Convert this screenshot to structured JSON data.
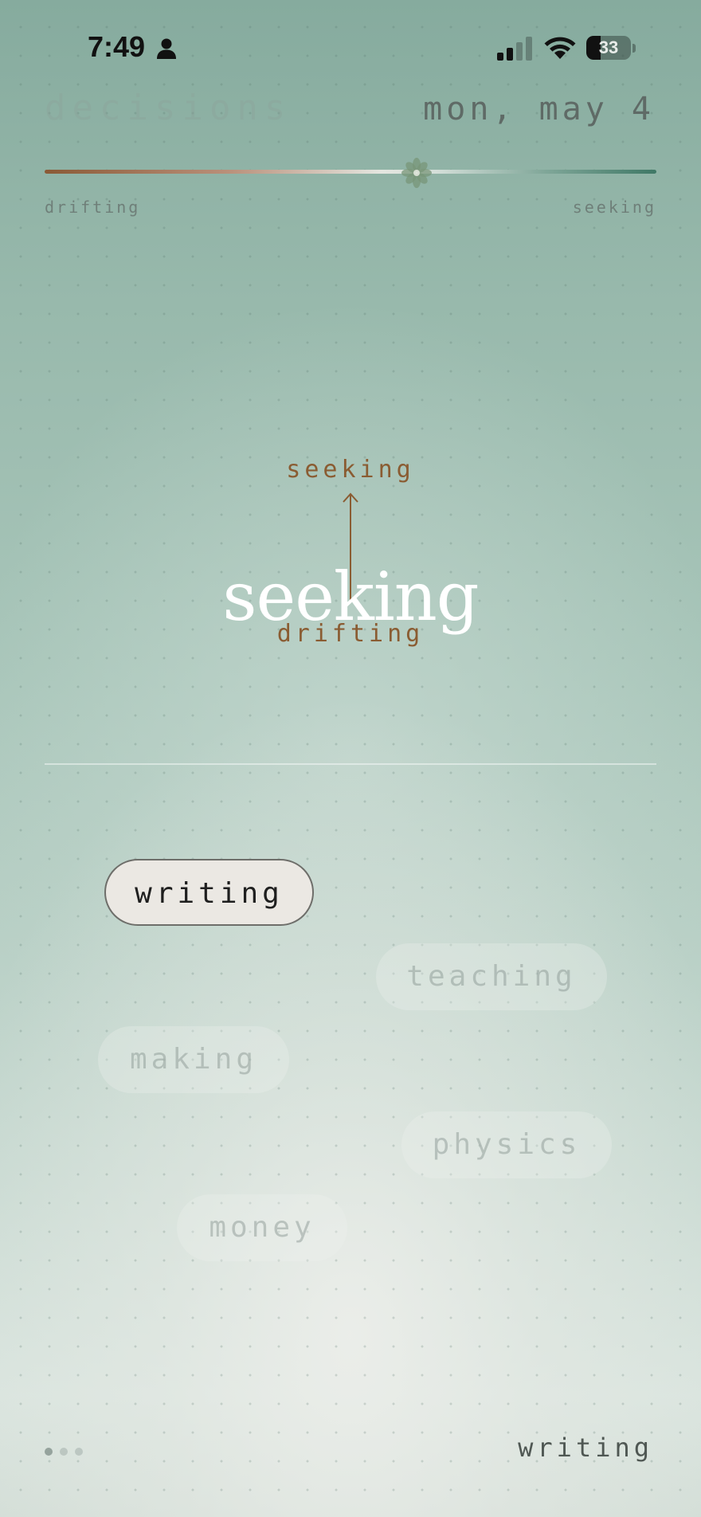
{
  "status_bar": {
    "time": "7:49",
    "battery": "33",
    "battery_level": 0.33,
    "icons": [
      "person-icon",
      "cellular-signal-icon",
      "wifi-icon",
      "battery-icon"
    ]
  },
  "header": {
    "title": "decisions",
    "date": "mon, may 4"
  },
  "slider": {
    "left_label": "drifting",
    "right_label": "seeking",
    "value": 0.6,
    "thumb_icon": "flower-icon"
  },
  "diagram": {
    "top_label": "seeking",
    "bottom_label": "drifting",
    "current_state": "seeking"
  },
  "topics": [
    {
      "label": "writing",
      "selected": true
    },
    {
      "label": "teaching",
      "selected": false
    },
    {
      "label": "making",
      "selected": false
    },
    {
      "label": "physics",
      "selected": false
    },
    {
      "label": "money",
      "selected": false
    }
  ],
  "footer": {
    "page_count": 3,
    "current_page": 1,
    "selected_topic": "writing"
  },
  "colors": {
    "accent_brown": "#8a5c32",
    "accent_green": "#3f7866"
  }
}
